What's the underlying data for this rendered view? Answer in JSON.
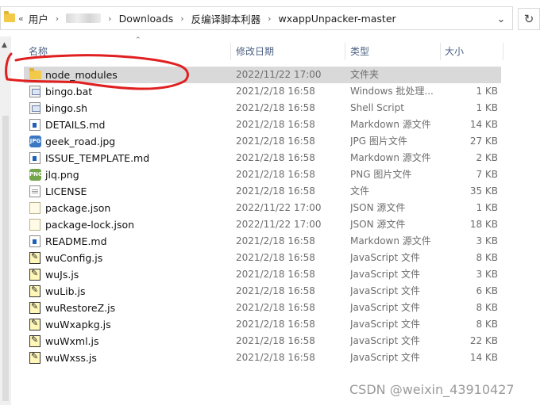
{
  "breadcrumb": [
    "用户",
    "",
    "Downloads",
    "反编译脚本利器",
    "wxappUnpacker-master"
  ],
  "columns": {
    "name": "名称",
    "date": "修改日期",
    "type": "类型",
    "size": "大小"
  },
  "files": [
    {
      "name": "node_modules",
      "date": "2022/11/22 17:00",
      "type": "文件夹",
      "size": "",
      "icon": "folder-icon"
    },
    {
      "name": "bingo.bat",
      "date": "2021/2/18 16:58",
      "type": "Windows 批处理...",
      "size": "1 KB",
      "icon": "batch-file-icon"
    },
    {
      "name": "bingo.sh",
      "date": "2021/2/18 16:58",
      "type": "Shell Script",
      "size": "1 KB",
      "icon": "shell-script-icon"
    },
    {
      "name": "DETAILS.md",
      "date": "2021/2/18 16:58",
      "type": "Markdown 源文件",
      "size": "14 KB",
      "icon": "markdown-file-icon"
    },
    {
      "name": "geek_road.jpg",
      "date": "2021/2/18 16:58",
      "type": "JPG 图片文件",
      "size": "27 KB",
      "icon": "jpg-image-icon"
    },
    {
      "name": "ISSUE_TEMPLATE.md",
      "date": "2021/2/18 16:58",
      "type": "Markdown 源文件",
      "size": "2 KB",
      "icon": "markdown-file-icon"
    },
    {
      "name": "jlq.png",
      "date": "2021/2/18 16:58",
      "type": "PNG 图片文件",
      "size": "7 KB",
      "icon": "png-image-icon"
    },
    {
      "name": "LICENSE",
      "date": "2021/2/18 16:58",
      "type": "文件",
      "size": "35 KB",
      "icon": "file-icon"
    },
    {
      "name": "package.json",
      "date": "2022/11/22 17:00",
      "type": "JSON 源文件",
      "size": "1 KB",
      "icon": "json-file-icon"
    },
    {
      "name": "package-lock.json",
      "date": "2022/11/22 17:00",
      "type": "JSON 源文件",
      "size": "18 KB",
      "icon": "json-file-icon"
    },
    {
      "name": "README.md",
      "date": "2021/2/18 16:58",
      "type": "Markdown 源文件",
      "size": "3 KB",
      "icon": "markdown-file-icon"
    },
    {
      "name": "wuConfig.js",
      "date": "2021/2/18 16:58",
      "type": "JavaScript 文件",
      "size": "8 KB",
      "icon": "javascript-file-icon"
    },
    {
      "name": "wuJs.js",
      "date": "2021/2/18 16:58",
      "type": "JavaScript 文件",
      "size": "3 KB",
      "icon": "javascript-file-icon"
    },
    {
      "name": "wuLib.js",
      "date": "2021/2/18 16:58",
      "type": "JavaScript 文件",
      "size": "6 KB",
      "icon": "javascript-file-icon"
    },
    {
      "name": "wuRestoreZ.js",
      "date": "2021/2/18 16:58",
      "type": "JavaScript 文件",
      "size": "8 KB",
      "icon": "javascript-file-icon"
    },
    {
      "name": "wuWxapkg.js",
      "date": "2021/2/18 16:58",
      "type": "JavaScript 文件",
      "size": "8 KB",
      "icon": "javascript-file-icon"
    },
    {
      "name": "wuWxml.js",
      "date": "2021/2/18 16:58",
      "type": "JavaScript 文件",
      "size": "22 KB",
      "icon": "javascript-file-icon"
    },
    {
      "name": "wuWxss.js",
      "date": "2021/2/18 16:58",
      "type": "JavaScript 文件",
      "size": "14 KB",
      "icon": "javascript-file-icon"
    }
  ],
  "watermark": "CSDN @weixin_43910427",
  "colors": {
    "annotation": "#e02020",
    "selected_row": "#d9d9d9",
    "header_text": "#4d6184"
  }
}
